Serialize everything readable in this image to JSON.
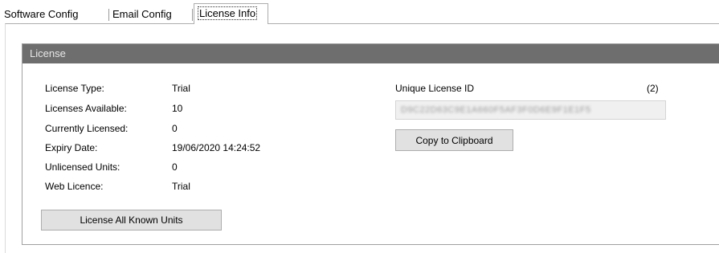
{
  "tabs": [
    {
      "label": "Software Config",
      "active": false
    },
    {
      "label": "Email Config",
      "active": false
    },
    {
      "label": "License Info",
      "active": true
    }
  ],
  "group": {
    "title": "License"
  },
  "fields": {
    "license_type": {
      "label": "License Type:",
      "value": "Trial"
    },
    "licenses_available": {
      "label": "Licenses Available:",
      "value": "10"
    },
    "currently_licensed": {
      "label": "Currently Licensed:",
      "value": "0"
    },
    "expiry_date": {
      "label": "Expiry Date:",
      "value": "19/06/2020 14:24:52"
    },
    "unlicensed_units": {
      "label": "Unlicensed Units:",
      "value": "0"
    },
    "web_licence": {
      "label": "Web Licence:",
      "value": "Trial"
    }
  },
  "unique_id": {
    "label": "Unique License ID",
    "count": "(2)",
    "value": "D9C22D63C9E1A660F5AF3F0D6E9F1E1F5"
  },
  "buttons": {
    "license_all": "License All Known Units",
    "copy_clipboard": "Copy to Clipboard"
  },
  "colors": {
    "header_bg": "#6e6e6e",
    "button_bg": "#e1e1e1"
  }
}
